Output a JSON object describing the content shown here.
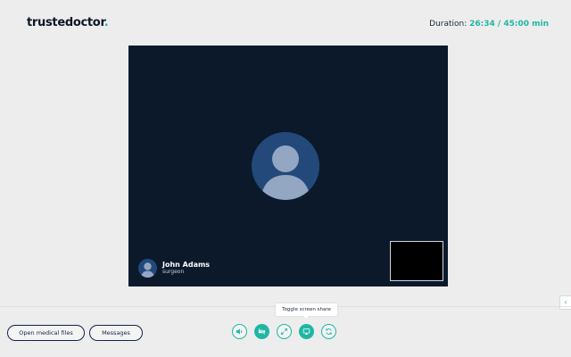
{
  "header": {
    "logo_text": "trustedoctor",
    "logo_dot": ".",
    "duration_label": "Duration:",
    "duration_value": "26:34 / 45:00 min"
  },
  "video": {
    "caller_name": "John Adams",
    "caller_role": "surgeon"
  },
  "footer": {
    "open_files_label": "Open medical files",
    "messages_label": "Messages",
    "tooltip": "Toggle screen share",
    "controls": [
      "volume-icon",
      "video-off-icon",
      "fullscreen-icon",
      "screen-share-icon",
      "refresh-icon"
    ],
    "side_tab_glyph": "‹"
  },
  "colors": {
    "accent": "#1fb7a4",
    "video_bg": "#0b192b",
    "avatar_bg": "#22497a",
    "navy": "#13244a"
  }
}
